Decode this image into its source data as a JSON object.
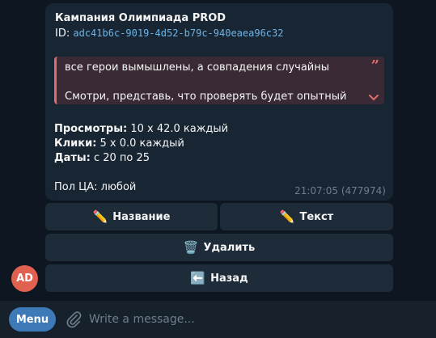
{
  "message": {
    "title": "Кампания Олимпиада PROD",
    "id_label": "ID:",
    "id_value": "adc41b6c-9019-4d52-b79c-940eaea96c32",
    "quote": {
      "line1": "все герои вымышлены, а совпадения случайны",
      "line2": "Смотри, представь, что проверять будет опытный",
      "mark": "”"
    },
    "stats": {
      "views_label": "Просмотры:",
      "views_value": " 10 x 42.0 каждый",
      "clicks_label": "Клики:",
      "clicks_value": " 5 x 0.0 каждый",
      "dates_label": "Даты:",
      "dates_value": " с 20 по 25"
    },
    "audience": "Пол ЦА: любой",
    "time": "21:07:05 (477974)"
  },
  "buttons": {
    "name": {
      "emoji": "✏️",
      "label": "Название"
    },
    "text": {
      "emoji": "✏️",
      "label": "Текст"
    },
    "delete": {
      "emoji": "🗑️",
      "label": "Удалить"
    },
    "back": {
      "emoji": "⬅️",
      "label": "Назад"
    }
  },
  "avatar": {
    "initials": "AD",
    "color": "#e0614f"
  },
  "composer": {
    "menu_label": "Menu",
    "placeholder": "Write a message..."
  },
  "icons": {
    "attach": "paperclip-icon",
    "expand": "chevron-down-icon",
    "quote": "quote-icon"
  },
  "colors": {
    "accent": "#3e7ab8",
    "quote_border": "#e06b6b",
    "id_link": "#6cb4e8"
  }
}
